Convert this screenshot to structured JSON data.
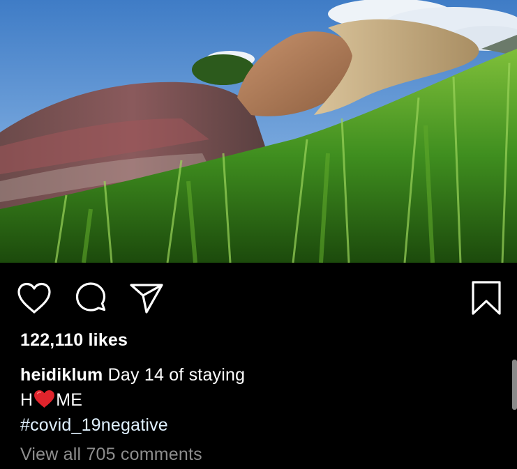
{
  "post": {
    "photo_alt": "",
    "likes_text": "122,110 likes",
    "caption": {
      "username": "heidiklum",
      "line1_text": " Day 14 of staying",
      "line2_before": "H",
      "line2_emoji": "red-heart-emoji",
      "line2_after": "ME",
      "hashtag": "#covid_19negative"
    },
    "view_comments_text": "View all 705 comments"
  },
  "icons": {
    "like": "heart-outline-icon",
    "comment": "speech-bubble-icon",
    "share": "paper-plane-icon",
    "save": "bookmark-icon"
  },
  "colors": {
    "background": "#000000",
    "text": "#ffffff",
    "muted": "#8e8e8e",
    "hashtag": "#e0f1ff",
    "heart": "#e0242c"
  }
}
